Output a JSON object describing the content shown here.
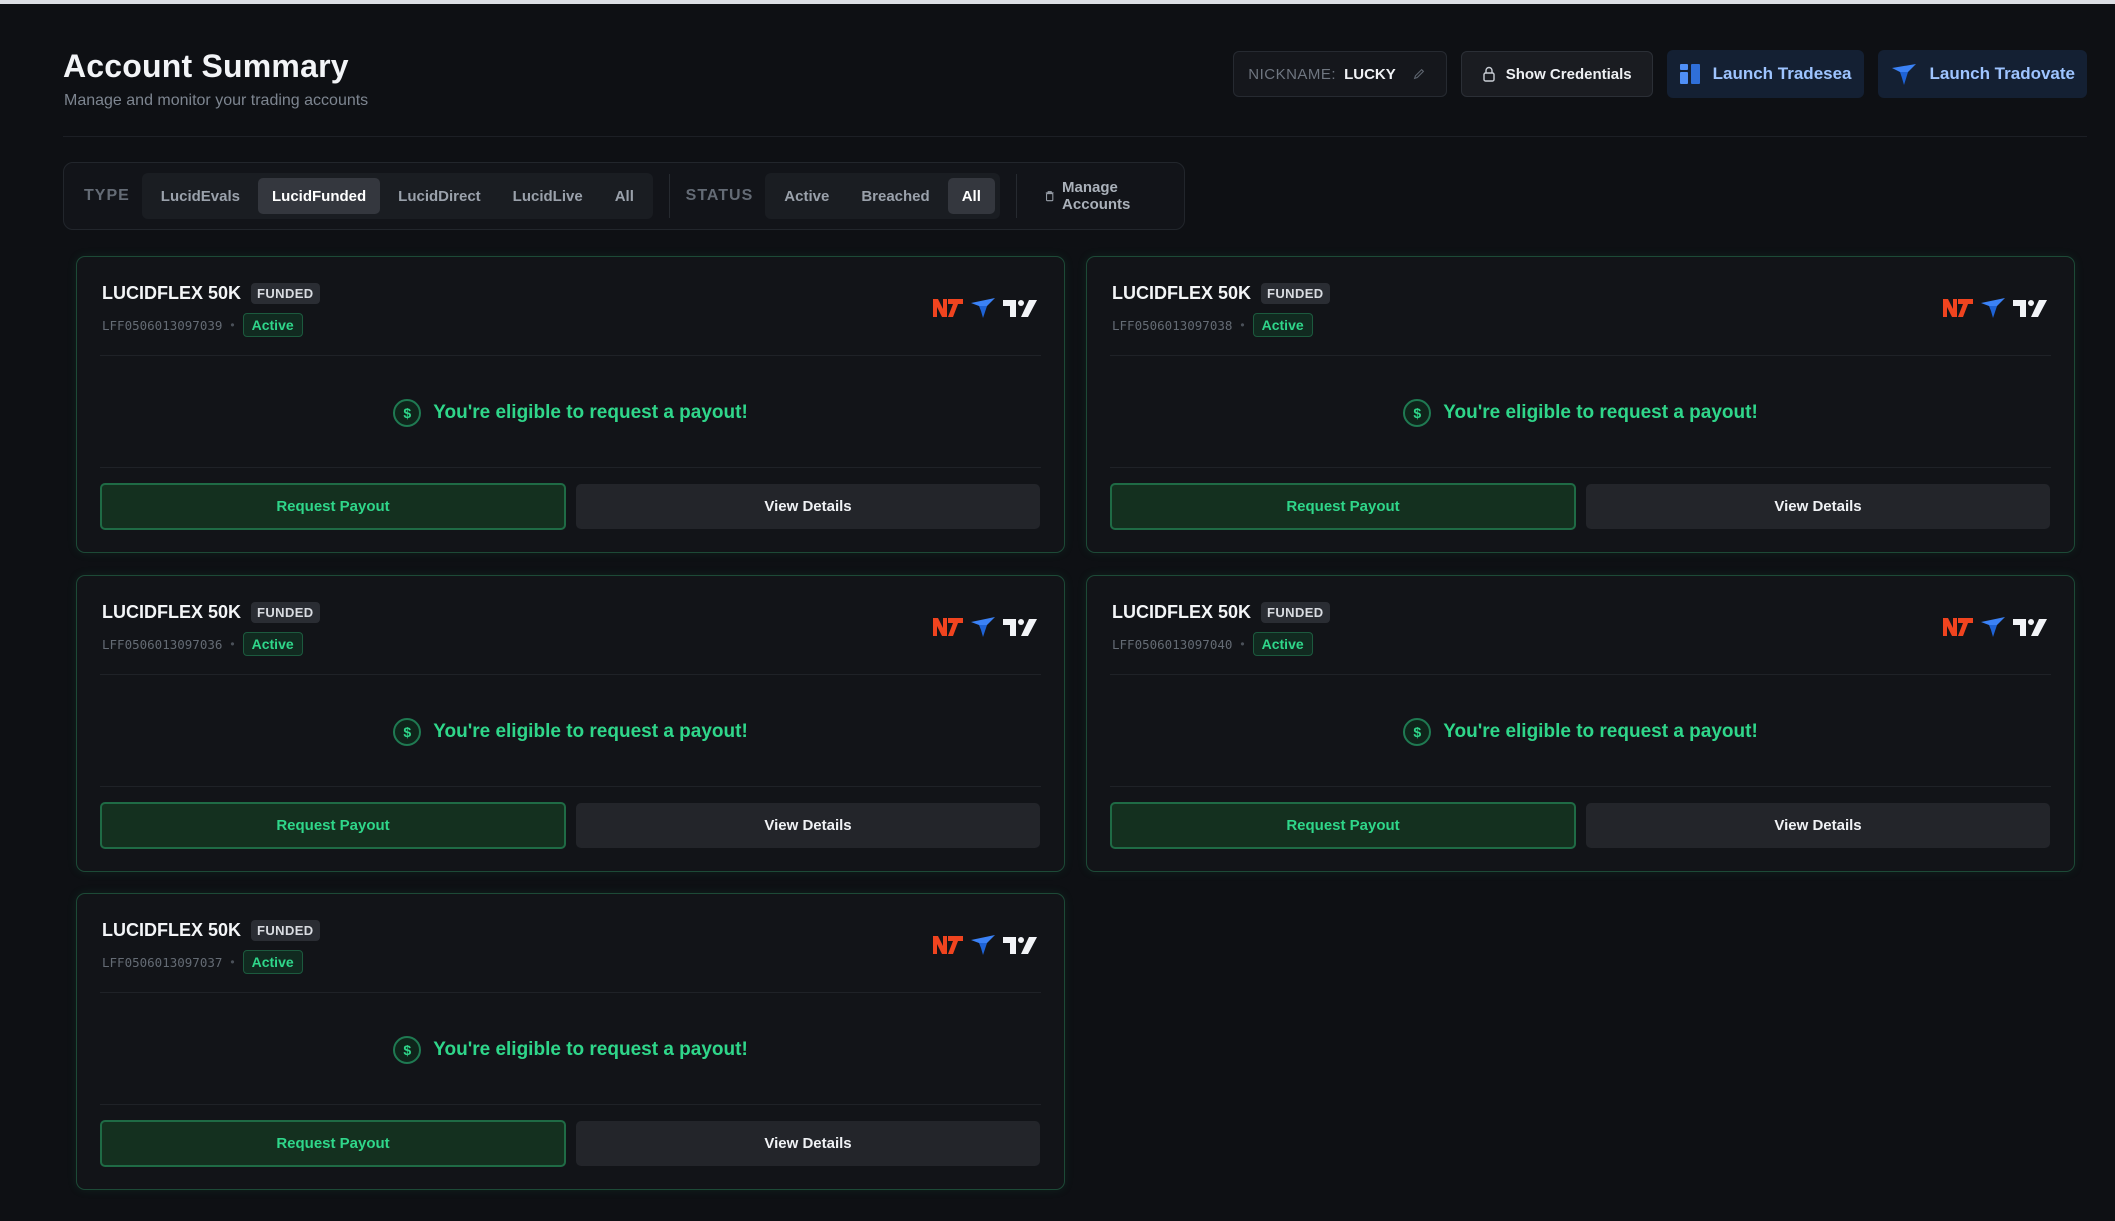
{
  "header": {
    "title": "Account Summary",
    "subtitle": "Manage and monitor your trading accounts",
    "nickname_label": "NICKNAME:",
    "nickname_value": "LUCKY",
    "show_credentials": "Show Credentials",
    "launch_tradesea": "Launch Tradesea",
    "launch_tradovate": "Launch Tradovate"
  },
  "filters": {
    "type_label": "TYPE",
    "type_options": [
      "LucidEvals",
      "LucidFunded",
      "LucidDirect",
      "LucidLive",
      "All"
    ],
    "type_selected": "LucidFunded",
    "status_label": "STATUS",
    "status_options": [
      "Active",
      "Breached",
      "All"
    ],
    "status_selected": "All",
    "manage_accounts": "Manage Accounts"
  },
  "accounts": [
    {
      "name": "LUCIDFLEX 50K",
      "type_badge": "FUNDED",
      "id": "LFF0506013097039",
      "status": "Active",
      "message": "You're eligible to request a payout!",
      "payout_label": "Request Payout",
      "details_label": "View Details"
    },
    {
      "name": "LUCIDFLEX 50K",
      "type_badge": "FUNDED",
      "id": "LFF0506013097038",
      "status": "Active",
      "message": "You're eligible to request a payout!",
      "payout_label": "Request Payout",
      "details_label": "View Details"
    },
    {
      "name": "LUCIDFLEX 50K",
      "type_badge": "FUNDED",
      "id": "LFF0506013097036",
      "status": "Active",
      "message": "You're eligible to request a payout!",
      "payout_label": "Request Payout",
      "details_label": "View Details"
    },
    {
      "name": "LUCIDFLEX 50K",
      "type_badge": "FUNDED",
      "id": "LFF0506013097040",
      "status": "Active",
      "message": "You're eligible to request a payout!",
      "payout_label": "Request Payout",
      "details_label": "View Details"
    },
    {
      "name": "LUCIDFLEX 50K",
      "type_badge": "FUNDED",
      "id": "LFF0506013097037",
      "status": "Active",
      "message": "You're eligible to request a payout!",
      "payout_label": "Request Payout",
      "details_label": "View Details"
    }
  ],
  "platform_icons": [
    "ninjatrader-icon",
    "tradovate-icon",
    "tradingview-icon"
  ],
  "colors": {
    "background": "#0e1014",
    "accent_green": "#2fd68a",
    "card_border": "#1d4a37",
    "ninjatrader": "#f0441f",
    "tradovate": "#2f7df0",
    "launch_text": "#9ec4ff"
  }
}
